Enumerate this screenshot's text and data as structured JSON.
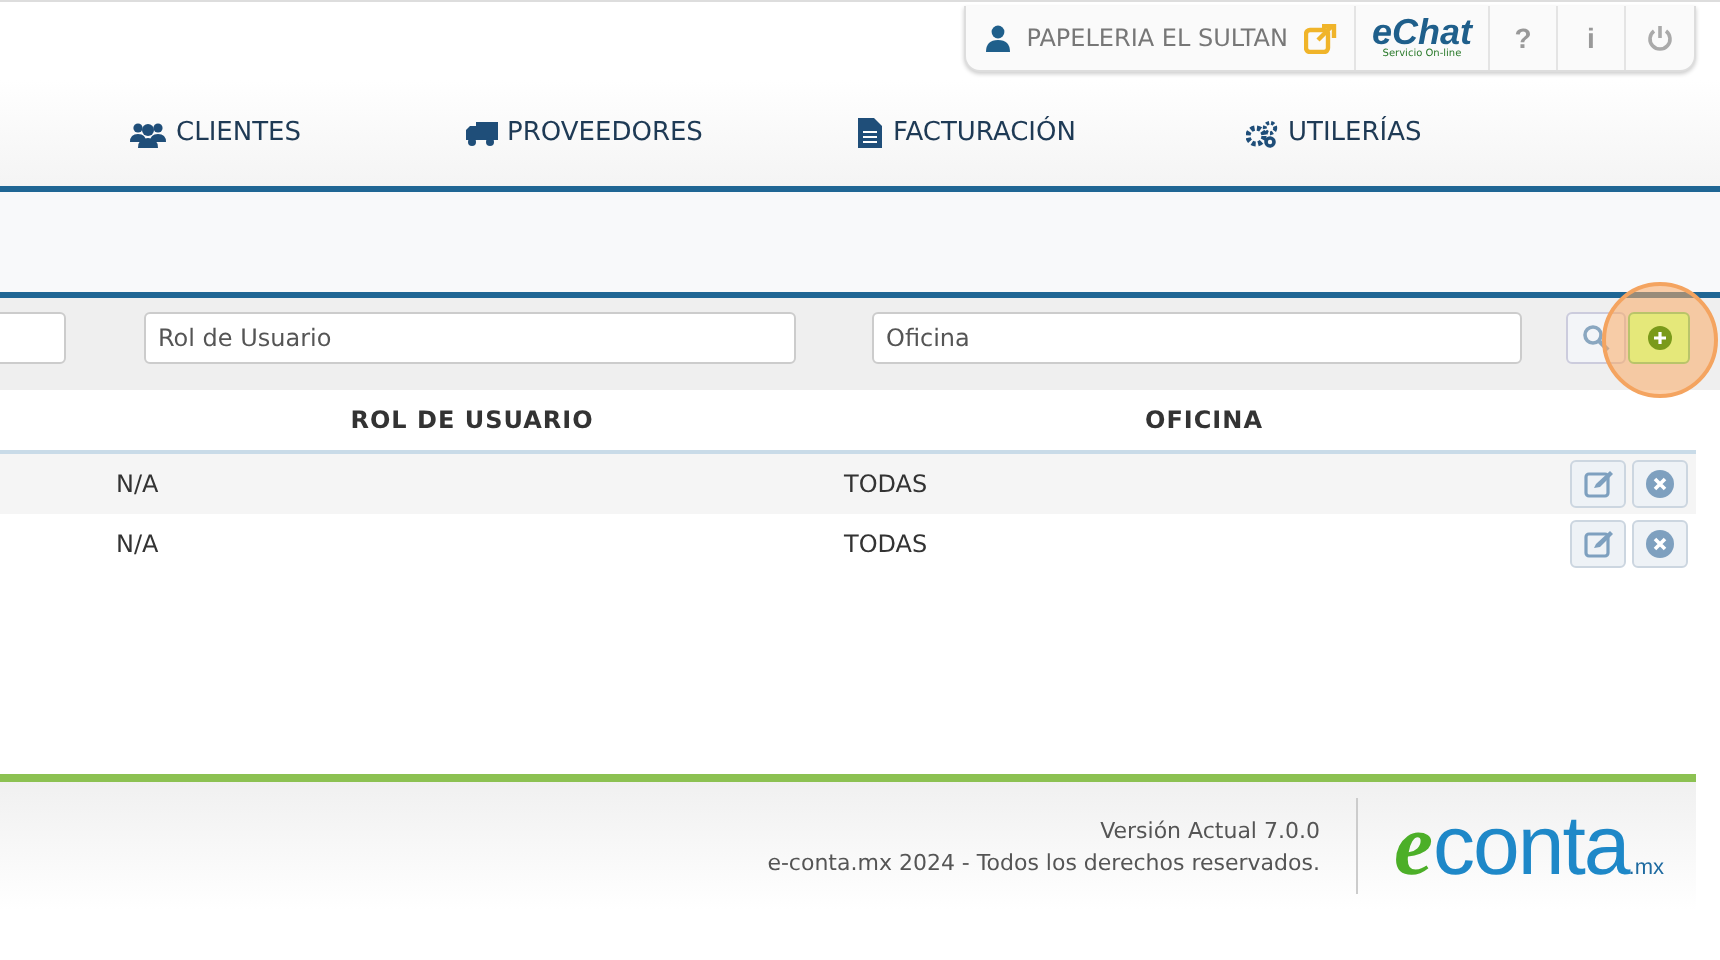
{
  "header": {
    "company": "PAPELERIA EL SULTAN",
    "chat_logo": {
      "name": "eChat",
      "tagline": "Servicio On-line"
    },
    "buttons": [
      {
        "kind": "text",
        "label": "?"
      },
      {
        "kind": "text",
        "label": "i"
      },
      {
        "kind": "power"
      }
    ]
  },
  "nav": [
    {
      "label": "CLIENTES"
    },
    {
      "label": "PROVEEDORES"
    },
    {
      "label": "FACTURACIÓN"
    },
    {
      "label": "UTILERÍAS"
    }
  ],
  "filters": [
    {
      "kind": "cut"
    },
    {
      "kind": "text",
      "placeholder": "Rol de Usuario"
    },
    {
      "kind": "text",
      "placeholder": "Oficina"
    }
  ],
  "table": {
    "columns": [
      "ROL DE USUARIO",
      "OFICINA"
    ],
    "rows": [
      {
        "rol": "N/A",
        "oficina": "TODAS"
      },
      {
        "rol": "N/A",
        "oficina": "TODAS"
      }
    ]
  },
  "footer": {
    "version": "Versión Actual 7.0.0",
    "copyright": "e-conta.mx 2024 - Todos los derechos reservados.",
    "logo": {
      "e": "e",
      "conta": "conta",
      "tld": ".mx"
    }
  }
}
